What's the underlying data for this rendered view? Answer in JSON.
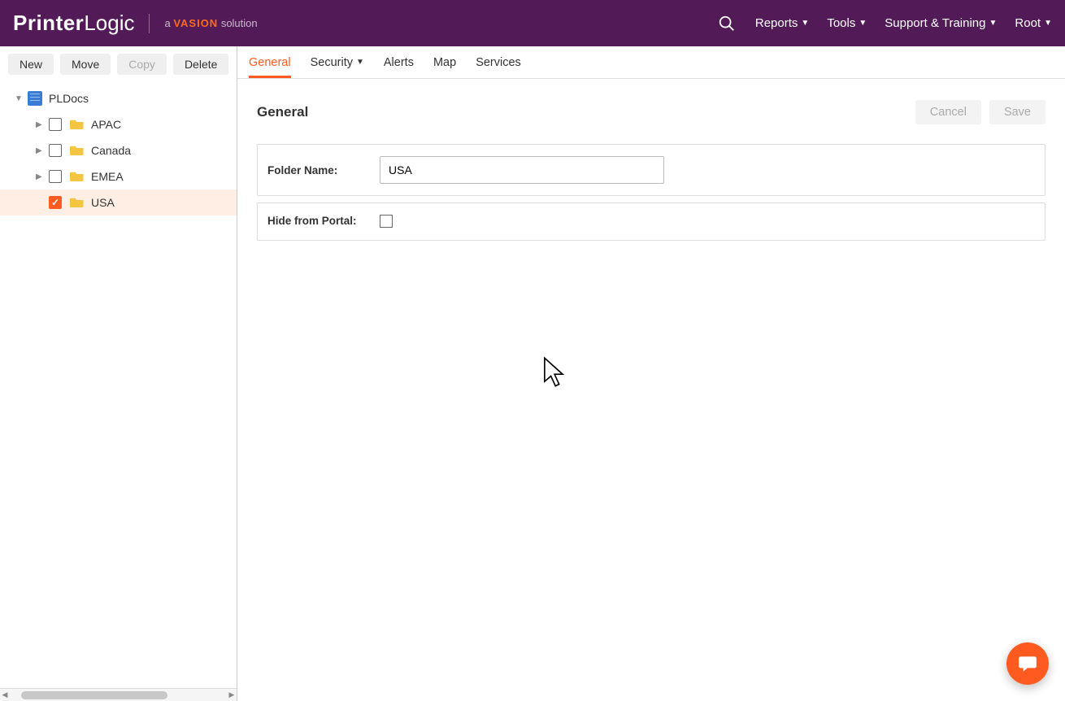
{
  "header": {
    "logo_bold": "Printer",
    "logo_light": "Logic",
    "tagline_prefix": "a ",
    "tagline_brand": "VASION",
    "tagline_suffix": " solution",
    "menu": {
      "reports": "Reports",
      "tools": "Tools",
      "support": "Support & Training",
      "root": "Root"
    }
  },
  "sidebar": {
    "buttons": {
      "new": "New",
      "move": "Move",
      "copy": "Copy",
      "delete": "Delete"
    },
    "root": "PLDocs",
    "items": [
      {
        "label": "APAC",
        "checked": false,
        "selected": false
      },
      {
        "label": "Canada",
        "checked": false,
        "selected": false
      },
      {
        "label": "EMEA",
        "checked": false,
        "selected": false
      },
      {
        "label": "USA",
        "checked": true,
        "selected": true
      }
    ]
  },
  "tabs": {
    "general": "General",
    "security": "Security",
    "alerts": "Alerts",
    "map": "Map",
    "services": "Services"
  },
  "content": {
    "title": "General",
    "cancel": "Cancel",
    "save": "Save",
    "folder_name_label": "Folder Name:",
    "folder_name_value": "USA",
    "hide_label": "Hide from Portal:"
  }
}
